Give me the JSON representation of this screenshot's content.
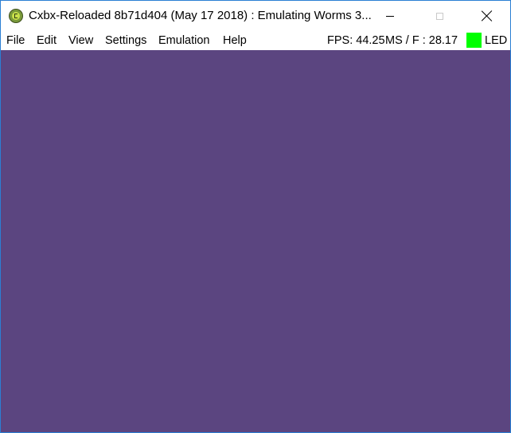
{
  "window": {
    "title": "Cxbx-Reloaded 8b71d404 (May 17 2018) : Emulating Worms 3..."
  },
  "icons": {
    "app": "cxbx-logo-icon",
    "minimize": "minimize-icon",
    "maximize": "maximize-icon",
    "close": "close-icon"
  },
  "menu": {
    "items": [
      {
        "label": "File"
      },
      {
        "label": "Edit"
      },
      {
        "label": "View"
      },
      {
        "label": "Settings"
      },
      {
        "label": "Emulation"
      },
      {
        "label": "Help"
      }
    ]
  },
  "status": {
    "fps": "FPS: 44.25",
    "ms_per_frame": "MS / F : 28.17",
    "led_label": "LED"
  },
  "colors": {
    "canvas_background": "#5b4580",
    "led_indicator": "#00ff00",
    "window_border": "#2b7fd4"
  }
}
